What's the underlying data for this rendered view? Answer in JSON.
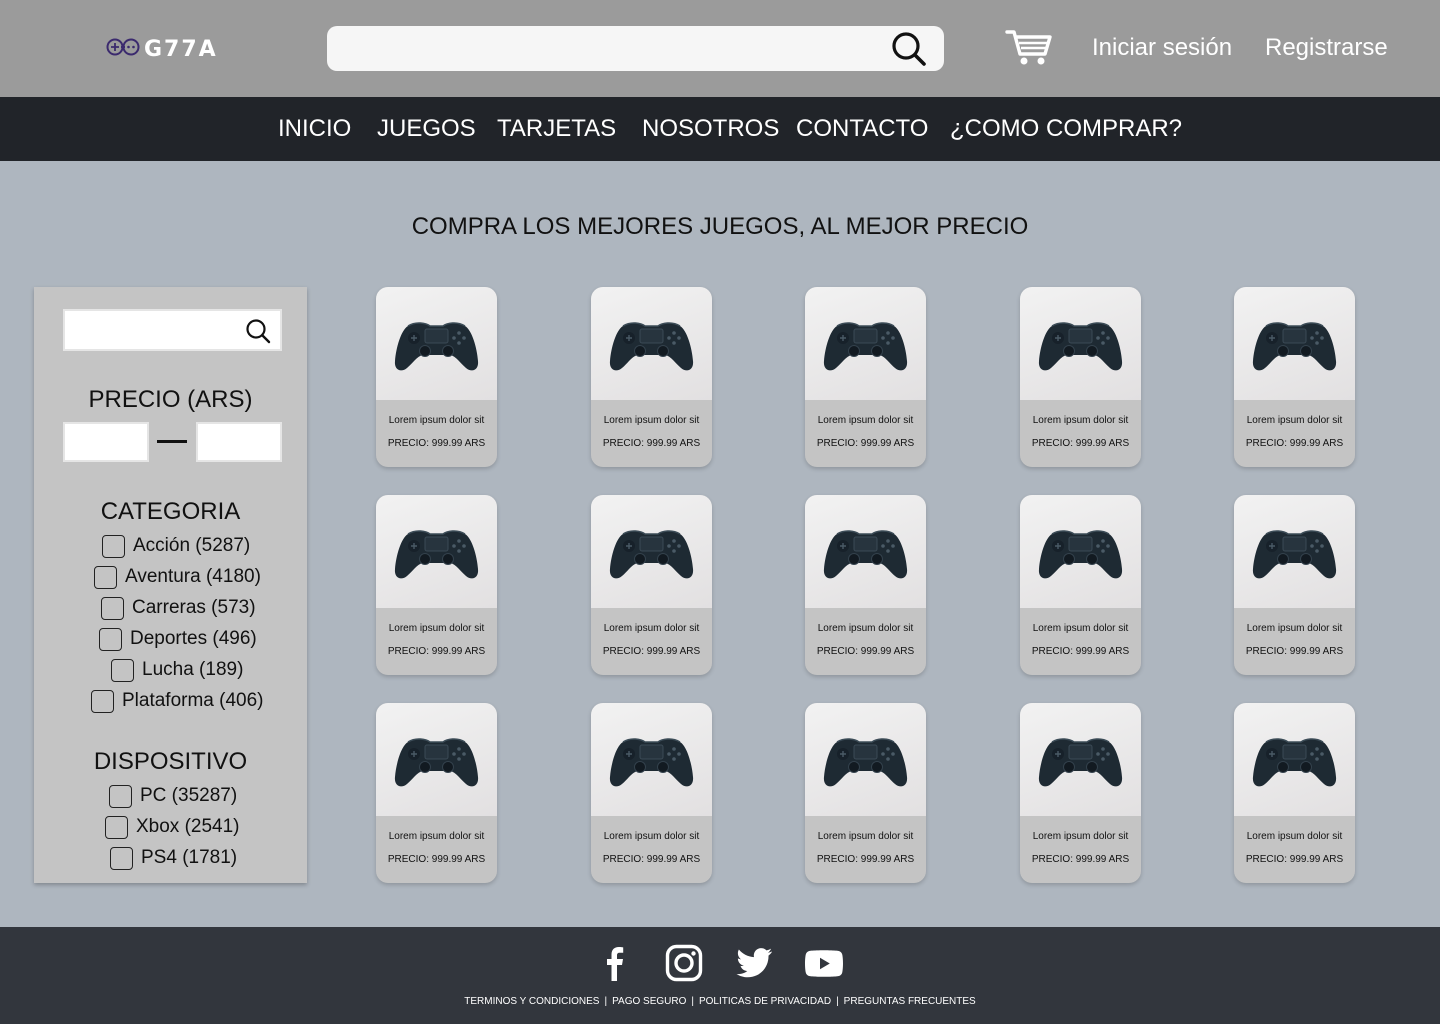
{
  "header": {
    "logo_text": "G77A",
    "logo_icon": "gamepad-icon",
    "search_placeholder": "",
    "search_icon": "search-icon",
    "cart_icon": "cart-icon",
    "login_label": "Iniciar sesión",
    "register_label": "Registrarse"
  },
  "nav": {
    "items": [
      {
        "label": "INICIO"
      },
      {
        "label": "JUEGOS"
      },
      {
        "label": "TARJETAS"
      },
      {
        "label": "NOSOTROS"
      },
      {
        "label": "CONTACTO"
      },
      {
        "label": "¿COMO COMPRAR?"
      }
    ]
  },
  "main": {
    "headline": "COMPRA LOS MEJORES JUEGOS, AL MEJOR PRECIO"
  },
  "sidebar": {
    "search_placeholder": "",
    "price_heading": "PRECIO (ARS)",
    "price_min": "",
    "price_max": "",
    "category_heading": "CATEGORIA",
    "categories": [
      {
        "label": "Acción (5287)",
        "checked": false
      },
      {
        "label": "Aventura (4180)",
        "checked": false
      },
      {
        "label": "Carreras (573)",
        "checked": false
      },
      {
        "label": "Deportes (496)",
        "checked": false
      },
      {
        "label": "Lucha (189)",
        "checked": false
      },
      {
        "label": "Plataforma (406)",
        "checked": false
      }
    ],
    "device_heading": "DISPOSITIVO",
    "devices": [
      {
        "label": "PC (35287)",
        "checked": false
      },
      {
        "label": "Xbox (2541)",
        "checked": false
      },
      {
        "label": "PS4 (1781)",
        "checked": false
      }
    ]
  },
  "products": [
    {
      "name": "Lorem ipsum dolor sit",
      "price": "PRECIO: 999.99 ARS"
    },
    {
      "name": "Lorem ipsum dolor sit",
      "price": "PRECIO: 999.99 ARS"
    },
    {
      "name": "Lorem ipsum dolor sit",
      "price": "PRECIO: 999.99 ARS"
    },
    {
      "name": "Lorem ipsum dolor sit",
      "price": "PRECIO: 999.99 ARS"
    },
    {
      "name": "Lorem ipsum dolor sit",
      "price": "PRECIO: 999.99 ARS"
    },
    {
      "name": "Lorem ipsum dolor sit",
      "price": "PRECIO: 999.99 ARS"
    },
    {
      "name": "Lorem ipsum dolor sit",
      "price": "PRECIO: 999.99 ARS"
    },
    {
      "name": "Lorem ipsum dolor sit",
      "price": "PRECIO: 999.99 ARS"
    },
    {
      "name": "Lorem ipsum dolor sit",
      "price": "PRECIO: 999.99 ARS"
    },
    {
      "name": "Lorem ipsum dolor sit",
      "price": "PRECIO: 999.99 ARS"
    },
    {
      "name": "Lorem ipsum dolor sit",
      "price": "PRECIO: 999.99 ARS"
    },
    {
      "name": "Lorem ipsum dolor sit",
      "price": "PRECIO: 999.99 ARS"
    },
    {
      "name": "Lorem ipsum dolor sit",
      "price": "PRECIO: 999.99 ARS"
    },
    {
      "name": "Lorem ipsum dolor sit",
      "price": "PRECIO: 999.99 ARS"
    },
    {
      "name": "Lorem ipsum dolor sit",
      "price": "PRECIO: 999.99 ARS"
    }
  ],
  "footer": {
    "social": [
      {
        "icon": "facebook-icon"
      },
      {
        "icon": "instagram-icon"
      },
      {
        "icon": "twitter-icon"
      },
      {
        "icon": "youtube-icon"
      }
    ],
    "links": [
      {
        "label": "TERMINOS Y CONDICIONES"
      },
      {
        "label": "PAGO SEGURO"
      },
      {
        "label": "POLITICAS DE PRIVACIDAD"
      },
      {
        "label": "PREGUNTAS FRECUENTES"
      }
    ],
    "separator": "|"
  },
  "colors": {
    "header_bg": "#9b9b9b",
    "nav_bg": "#212429",
    "page_bg": "#aeb6bf",
    "sidebar_bg": "#c4c4c4",
    "card_bg": "#c4c4c4",
    "footer_bg": "#32363d",
    "logo_accent": "#3b2a6e"
  }
}
